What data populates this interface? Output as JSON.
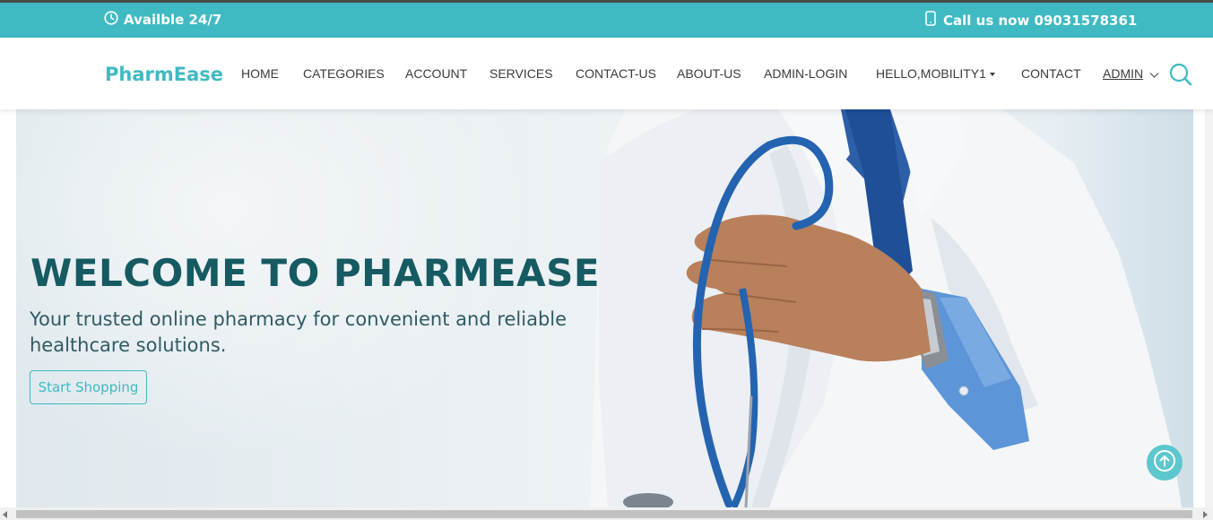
{
  "topbar": {
    "availability": "Availble 24/7",
    "availability_icon": "clock-icon",
    "call": "Call us now 09031578361",
    "call_icon": "phone-icon"
  },
  "brand": "PharmEase",
  "nav": {
    "items": [
      "HOME",
      "CATEGORIES",
      "ACCOUNT",
      "SERVICES",
      "CONTACT-US",
      "ABOUT-US",
      "ADMIN-LOGIN",
      "HELLO,MOBILITY1",
      "CONTACT",
      "ADMIN"
    ],
    "search_icon": "search-icon"
  },
  "hero": {
    "title": "WELCOME TO PHARMEASE",
    "subtitle": "Your trusted online pharmacy for convenient and reliable healthcare solutions.",
    "cta": "Start Shopping"
  },
  "colors": {
    "accent": "#3fbac2",
    "title": "#165a62"
  }
}
